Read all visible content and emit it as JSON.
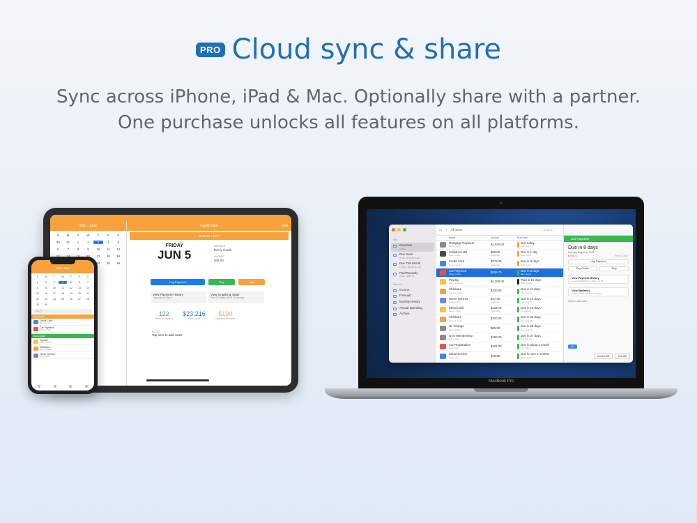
{
  "header": {
    "pro_badge": "PRO",
    "title": "Cloud sync & share",
    "subtitle_line1": "Sync across iPhone, iPad & Mac. Optionally share with a partner.",
    "subtitle_line2": "One purchase unlocks all features on all platforms."
  },
  "ipad": {
    "left_title": "Bills - June",
    "calendar_days": [
      "S",
      "M",
      "T",
      "W",
      "T",
      "F",
      "S",
      "30",
      "31",
      "1",
      "2",
      "3",
      "4",
      "5",
      "6",
      "7",
      "8",
      "9",
      "10",
      "11",
      "12",
      "13",
      "14",
      "15",
      "16",
      "17",
      "18",
      "19",
      "20",
      "21",
      "22",
      "23",
      "24",
      "25",
      "26",
      "27"
    ],
    "selected_day_index": 11,
    "right_title": "Credit Card",
    "edit_label": "Edit",
    "due_band": "DUE IN 1 DAY",
    "weekday": "FRIDAY",
    "date": "JUN 5",
    "repeats_label": "REPEATS",
    "repeats_value": "Every month",
    "amount_label": "AMOUNT",
    "amount_value": "$45.00",
    "btn_log": "Log Payment",
    "btn_pay": "Pay",
    "btn_skip": "Skip",
    "card1_title": "View Payment History",
    "card1_sub": "Last paid on May 6",
    "card2_title": "View Graphs & Stats",
    "card2_sub": "Paid 122 times, $190.00 average",
    "stat1_value": "122",
    "stat1_label": "TOTAL PAYMENTS",
    "stat2_value": "$23,216",
    "stat2_label": "TOTAL PAID",
    "stat3_value": "$190",
    "stat3_label": "AVERAGE PAYMENT",
    "notes_label": "NOTES",
    "notes_value": "Tap here to add notes",
    "colors": {
      "orange": "#f7a23c",
      "blue": "#1e7cf2",
      "green": "#3ab84f",
      "stat1": "#3ab84f",
      "stat2": "#1e7cf2",
      "stat3": "#f7a23c"
    }
  },
  "iphone": {
    "title": "Bills - June",
    "calendar_days": [
      "S",
      "M",
      "T",
      "W",
      "T",
      "F",
      "S",
      "1",
      "2",
      "3",
      "4",
      "5",
      "6",
      "7",
      "8",
      "9",
      "10",
      "11",
      "12",
      "13",
      "14",
      "15",
      "16",
      "17",
      "18",
      "19",
      "20",
      "21",
      "22",
      "23",
      "24",
      "25",
      "26",
      "27",
      "28",
      "29",
      "30"
    ],
    "selected_day_index": 10,
    "search_placeholder": "Search",
    "band1": "DUE SOON",
    "band2": "DUE LATER",
    "rows": [
      {
        "name": "Credit Card",
        "sub": "Due in 1 day",
        "color": "#4a86d8"
      },
      {
        "name": "Car Payment",
        "sub": "Due in 8 days",
        "color": "#e5534b"
      },
      {
        "name": "Payday",
        "sub": "Every 2 weeks",
        "color": "#f4c542"
      },
      {
        "name": "Childcare",
        "sub": "Every 2 weeks",
        "color": "#f7a23c"
      },
      {
        "name": "Home Internet",
        "sub": "Every month",
        "color": "#6b8bd6"
      }
    ]
  },
  "mac": {
    "device_label": "MacBook Pro",
    "sidebar": {
      "section1": "Bills",
      "items": [
        {
          "label": "Overview",
          "sub": "14 bills"
        },
        {
          "label": "Due Soon",
          "sub": "3 bills · $1,066 (in est)"
        },
        {
          "label": "Due This Month",
          "sub": "11 bills · $3,236 (in est)"
        },
        {
          "label": "Paid Recently",
          "sub": "2 bills · $358.04"
        }
      ],
      "section2": "Reports",
      "reports": [
        "Income",
        "Forecast",
        "Monthly History",
        "Annual Spending",
        "Archive"
      ]
    },
    "toolbar": {
      "filter": "All Items",
      "search_placeholder": "Search"
    },
    "columns": {
      "name": "Name",
      "amount": "Amount",
      "due": "Due Date"
    },
    "rows": [
      {
        "name": "Mortgage Payment",
        "sub": "Every month",
        "amount": "$1,640.00",
        "amount_sub": "",
        "due": "Due today",
        "due_sub": "Sun, Aug 1",
        "pill": "#f7a23c",
        "icon": "#8a8a8a"
      },
      {
        "name": "Cellphone Bill",
        "sub": "Every month",
        "amount": "$80.00",
        "amount_sub": "(estimate)",
        "due": "Due in 1 day",
        "due_sub": "Mon, Aug 2",
        "pill": "#f7a23c",
        "icon": "#4a4a4a"
      },
      {
        "name": "Credit Card",
        "sub": "Every month",
        "amount": "$271.65",
        "amount_sub": "(estimate)",
        "due": "Due in 3 days",
        "due_sub": "Wed, Aug 4",
        "pill": "#f7a23c",
        "icon": "#3f86e8"
      },
      {
        "name": "Car Payment",
        "sub": "Every month",
        "amount": "$208.70",
        "amount_sub": "",
        "due": "Due in 8 days",
        "due_sub": "Mon, Aug 9",
        "pill": "#3ab84f",
        "icon": "#e5534b",
        "selected": true
      },
      {
        "name": "Payday",
        "sub": "Every 2 weeks",
        "amount": "$4,300.00",
        "amount_sub": "",
        "due": "Paid in 10 days",
        "due_sub": "Wed, Aug 11",
        "pill": "#222222",
        "icon": "#f4c542"
      },
      {
        "name": "Childcare",
        "sub": "Every 2 weeks",
        "amount": "$320.00",
        "amount_sub": "",
        "due": "Due in 11 days",
        "due_sub": "Thu, Aug 12",
        "pill": "#3ab84f",
        "icon": "#f7a23c"
      },
      {
        "name": "Home Internet",
        "sub": "Every month",
        "amount": "$47.49",
        "amount_sub": "(estimate)",
        "due": "Due in 16 days",
        "due_sub": "Tue, Aug 17",
        "pill": "#3ab84f",
        "icon": "#6b8bd6"
      },
      {
        "name": "Electric Bill",
        "sub": "Every month",
        "amount": "$123.76",
        "amount_sub": "(estimate)",
        "due": "Due in 19 days",
        "due_sub": "Fri, Aug 20",
        "pill": "#3ab84f",
        "icon": "#f4c542"
      },
      {
        "name": "Childcare",
        "sub": "Every 2 weeks",
        "amount": "$320.00",
        "amount_sub": "",
        "due": "Due in 25 days",
        "due_sub": "Thu, Aug 26",
        "pill": "#3ab84f",
        "icon": "#f7a23c"
      },
      {
        "name": "Oil Change",
        "sub": "Every quarter",
        "amount": "$59.99",
        "amount_sub": "",
        "due": "Due in 28 days",
        "due_sub": "Sun, Aug 29",
        "pill": "#3ab84f",
        "icon": "#8a8a8a"
      },
      {
        "name": "Gym Membership",
        "sub": "Every year",
        "amount": "$150.00",
        "amount_sub": "",
        "due": "Due in 27 days",
        "due_sub": "Sat, Aug 28",
        "pill": "#3ab84f",
        "icon": "#8a8a8a"
      },
      {
        "name": "Car Registration",
        "sub": "Every year",
        "amount": "$101.00",
        "amount_sub": "",
        "due": "Due in about 1 month",
        "due_sub": "Thu, Sep 2",
        "pill": "#3ab84f",
        "icon": "#e5534b"
      },
      {
        "name": "Cloud Service",
        "sub": "Every year",
        "amount": "$19.99",
        "amount_sub": "",
        "due": "Due in over 3 months",
        "due_sub": "Mon, Nov 8",
        "pill": "#3ab84f",
        "icon": "#3f86e8"
      }
    ],
    "detail": {
      "title": "Car Payment",
      "due": "Due in 8 days",
      "date": "Monday, August 9, 2021",
      "amount": "$208.70",
      "ends": "Ends 3/2027",
      "btn_log": "Log Payment",
      "btn_pay": "Pay Online",
      "btn_skip": "Skip",
      "card1_title": "View Payment History",
      "card1_sub": "Last Paid $208.70 on Wed, Jul 28",
      "card2_title": "View Statistics",
      "card2_sub": "Paid 23 times, $208.70 average",
      "notes": "Click to add notes",
      "tag": "Car",
      "archive": "Archive Bill",
      "edit": "Edit Bill"
    }
  }
}
